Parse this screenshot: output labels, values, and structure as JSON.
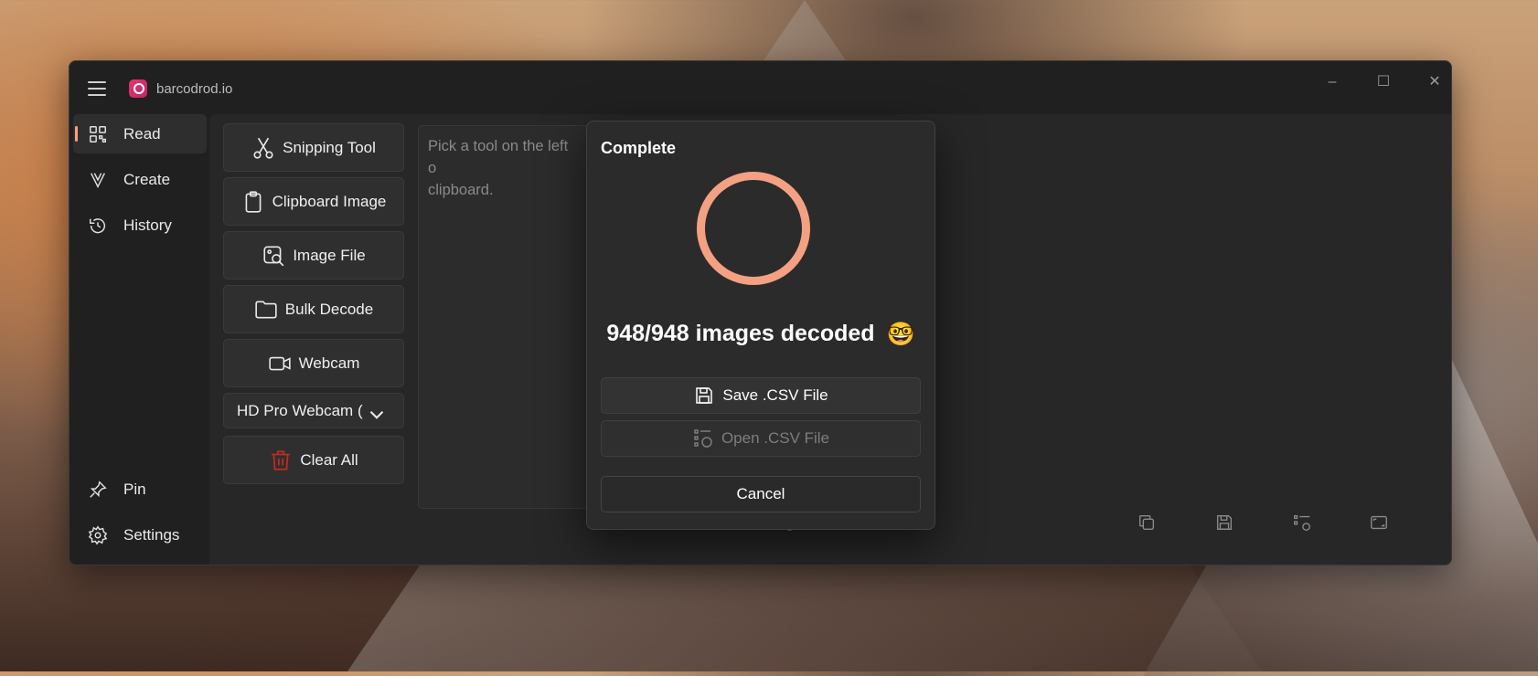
{
  "app": {
    "title": "barcodrod.io"
  },
  "window_controls": {
    "minimize": "–",
    "maximize": "☐",
    "close": "✕"
  },
  "nav": {
    "items": [
      {
        "label": "Read",
        "icon": "qr-code-icon",
        "active": true
      },
      {
        "label": "Create",
        "icon": "create-icon"
      },
      {
        "label": "History",
        "icon": "history-icon"
      }
    ],
    "footer": [
      {
        "label": "Pin",
        "icon": "pin-icon"
      },
      {
        "label": "Settings",
        "icon": "gear-icon"
      }
    ]
  },
  "tools": {
    "snipping": "Snipping Tool",
    "clipboard": "Clipboard Image",
    "image_file": "Image File",
    "bulk_decode": "Bulk Decode",
    "webcam": "Webcam",
    "webcam_select": "HD Pro Webcam (",
    "clear_all": "Clear All"
  },
  "text_area": {
    "placeholder": "Pick a tool on the left o\nclipboard."
  },
  "dialog": {
    "title": "Complete",
    "status": "948/948 images decoded",
    "status_emoji": "🤓",
    "save_csv": "Save .CSV File",
    "open_csv": "Open .CSV File",
    "cancel": "Cancel",
    "progress_color": "#f4a183"
  },
  "colors": {
    "accent": "#f4a183",
    "window_bg": "#202020",
    "content_bg": "#272727",
    "clear_icon": "#c42b1c"
  }
}
